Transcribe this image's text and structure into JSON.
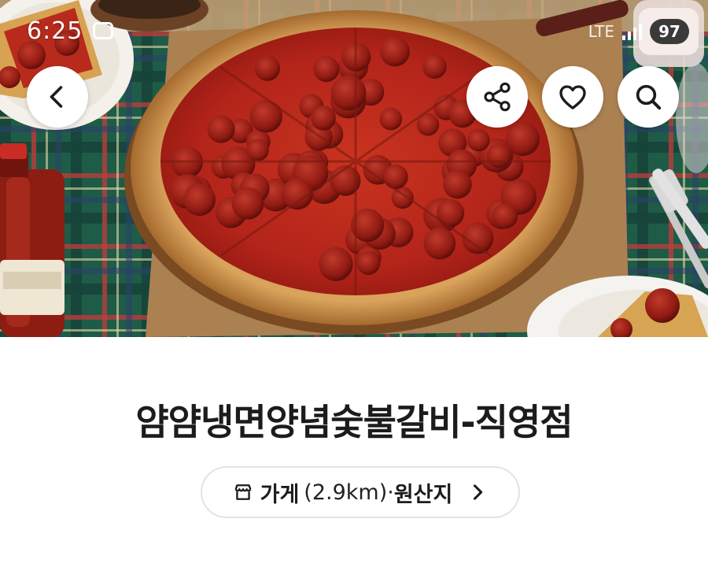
{
  "status_bar": {
    "time": "6:25",
    "network": "LTE",
    "battery": "97"
  },
  "header": {
    "back_icon": "chevron-left-icon",
    "share_icon": "share-icon",
    "like_icon": "heart-icon",
    "search_icon": "search-icon"
  },
  "hero": {
    "description_colors": {
      "tablecloth": "#1f5a45",
      "crust": "#d9a35c",
      "sauce": "#b5221a",
      "pepperoni": "#8f1a12"
    }
  },
  "store": {
    "name": "얌얌냉면양념숯불갈비-직영점",
    "info_label": "가게",
    "distance": "(2.9km)",
    "separator": "·",
    "origin_label": "원산지",
    "store_icon": "store-icon",
    "chevron_icon": "chevron-right-icon"
  }
}
